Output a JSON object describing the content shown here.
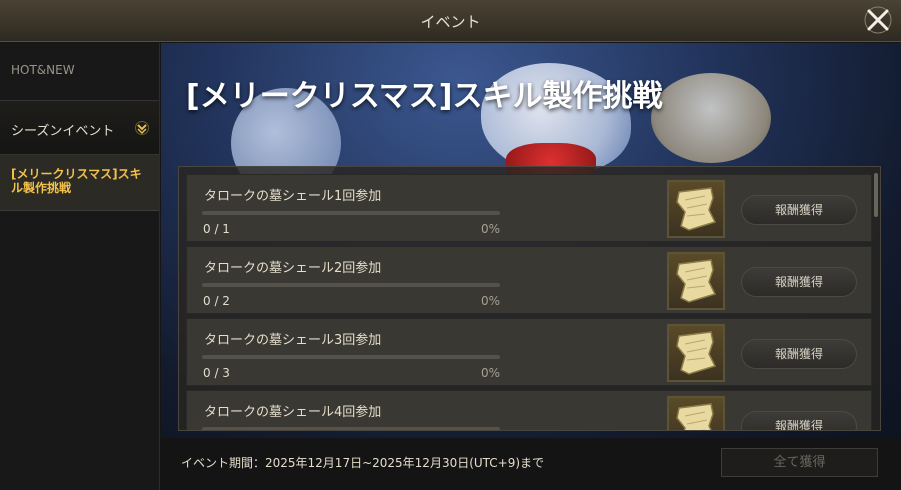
{
  "window": {
    "title": "イベント"
  },
  "sidebar": {
    "hot_label": "HOT&NEW",
    "season_label": "シーズンイベント",
    "active_label": "[メリークリスマス]スキル製作挑戦"
  },
  "banner": {
    "title": "[メリークリスマス]スキル製作挑戦"
  },
  "missions": [
    {
      "title": "タロークの墓シェール1回参加",
      "count": "0 / 1",
      "percent": "0%",
      "progress": 0,
      "button": "報酬獲得"
    },
    {
      "title": "タロークの墓シェール2回参加",
      "count": "0 / 2",
      "percent": "0%",
      "progress": 0,
      "button": "報酬獲得"
    },
    {
      "title": "タロークの墓シェール3回参加",
      "count": "0 / 3",
      "percent": "0%",
      "progress": 0,
      "button": "報酬獲得"
    },
    {
      "title": "タロークの墓シェール4回参加",
      "count": "",
      "percent": "",
      "progress": 0,
      "button": "報酬獲得"
    }
  ],
  "footer": {
    "period": "イベント期間：2025年12月17日~2025年12月30日(UTC+9)まで",
    "claim_all": "全て獲得"
  },
  "icons": {
    "close": "close-icon",
    "chevron": "chevron-down-icon",
    "reward": "scroll-icon"
  },
  "colors": {
    "accent": "#f3c24a",
    "progress_fill": "#c9a64a"
  }
}
